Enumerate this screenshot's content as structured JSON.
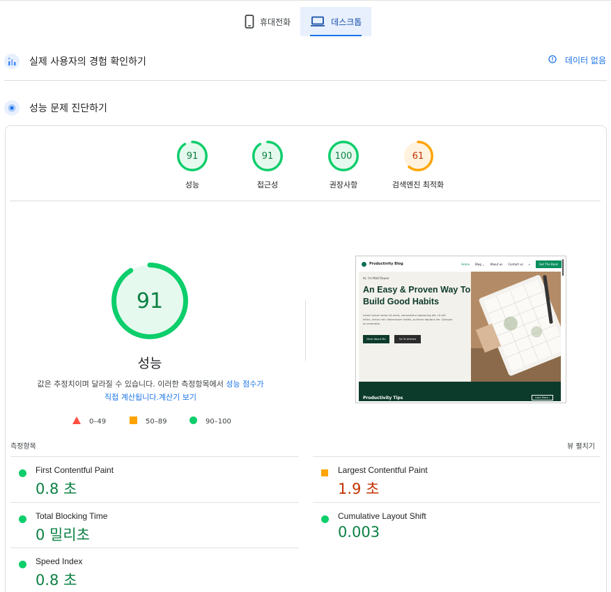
{
  "tabs": [
    {
      "label": "휴대전화",
      "icon": "mobile-phone-icon",
      "active": false
    },
    {
      "label": "데스크톱",
      "icon": "laptop-icon",
      "active": true
    }
  ],
  "field_data": {
    "title": "실제 사용자의 경험 확인하기",
    "icon": "users-chart-icon",
    "status": "데이터 없음",
    "status_icon": "info-icon"
  },
  "lab": {
    "title": "성능 문제 진단하기",
    "icon": "lab-flask-icon"
  },
  "categories": [
    {
      "label": "성능",
      "score": "91",
      "fraction": 0.91,
      "color": "#0cce6b"
    },
    {
      "label": "접근성",
      "score": "91",
      "fraction": 0.91,
      "color": "#0cce6b"
    },
    {
      "label": "권장사항",
      "score": "100",
      "fraction": 1.0,
      "color": "#0cce6b"
    },
    {
      "label": "검색엔진 최적화",
      "score": "61",
      "fraction": 0.61,
      "color": "#ffa400"
    }
  ],
  "performance": {
    "score": "91",
    "fraction": 0.91,
    "label": "성능",
    "desc_1": "값은 추정치이며 달라질 수 있습니다. 이러한 측정항목에서 ",
    "desc_link": "성능 점수가",
    "desc_2": "직접 계산됩니다.",
    "calc_link": "계산기 보기"
  },
  "legend": [
    {
      "shape": "triangle",
      "range": "0–49",
      "color": "#ff4e42"
    },
    {
      "shape": "square",
      "range": "50–89",
      "color": "#ffa400"
    },
    {
      "shape": "circle",
      "range": "90–100",
      "color": "#0cce6b"
    }
  ],
  "preview": {
    "brand": "Productivity Blog",
    "nav": [
      "Home",
      "Blog ⌄",
      "About us",
      "Contact us"
    ],
    "cta": "Get The Book",
    "greeting": "Hi, I'm Matt Rowse",
    "headline": "An Easy & Proven Way To Build Good Habits",
    "body": "Lorem ipsum dolor sit amet, consectetur adipiscing elit. Ut elit tellus, luctus nec ullamcorper mattis, pulvinar dapibus leo. Quisque at venenatis.",
    "btn1": "More About Me",
    "btn2": "Go To Articles",
    "footer_title": "Productivity Tips",
    "footer_btn": "Load More ›"
  },
  "metrics_header": {
    "title": "측정항목",
    "expand": "뷰 펼치기"
  },
  "metrics": [
    {
      "name": "First Contentful Paint",
      "value": "0.8 초",
      "rating": "good"
    },
    {
      "name": "Largest Contentful Paint",
      "value": "1.9 초",
      "rating": "average"
    },
    {
      "name": "Total Blocking Time",
      "value": "0 밀리초",
      "rating": "good"
    },
    {
      "name": "Cumulative Layout Shift",
      "value": "0.003",
      "rating": "good"
    },
    {
      "name": "Speed Index",
      "value": "0.8 초",
      "rating": "good"
    }
  ],
  "colors": {
    "good": "#0cce6b",
    "average": "#ffa400",
    "good_text": "#0b8043",
    "average_text": "#c33300",
    "link": "#1a73e8"
  }
}
